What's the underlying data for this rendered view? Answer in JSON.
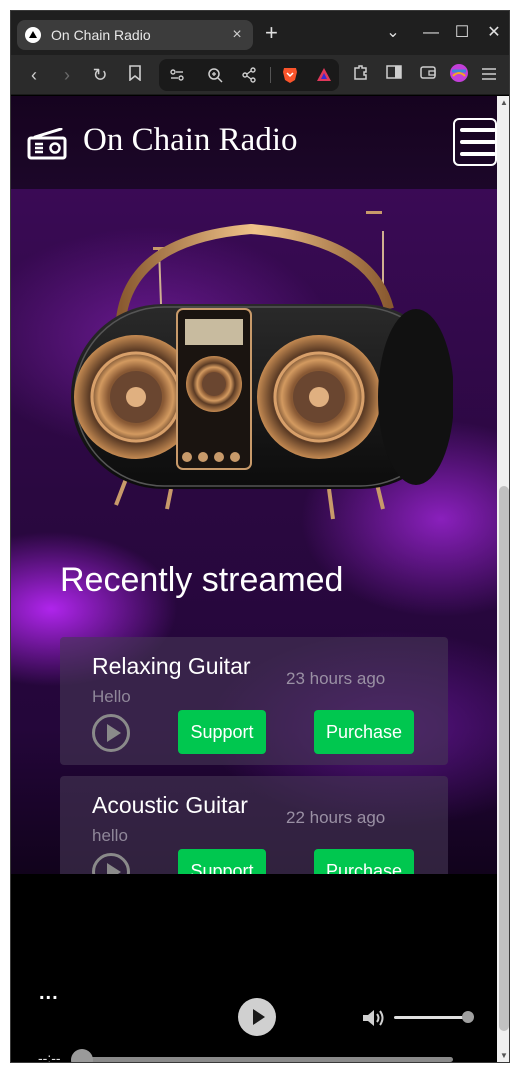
{
  "browser": {
    "tab_title": "On Chain Radio",
    "tab_close": "×",
    "new_tab": "+",
    "win_dropdown": "⌄",
    "win_min": "—",
    "win_max": "☐",
    "win_close": "✕"
  },
  "site": {
    "title": "On Chain Radio"
  },
  "recent": {
    "heading": "Recently streamed",
    "tracks": [
      {
        "title": "Relaxing Guitar",
        "description": "Hello",
        "time": "23 hours ago",
        "support_label": "Support",
        "purchase_label": "Purchase"
      },
      {
        "title": "Acoustic Guitar",
        "description": "hello",
        "time": "22 hours ago",
        "support_label": "Support",
        "purchase_label": "Purchase"
      }
    ]
  },
  "player": {
    "now_playing": "...",
    "time": "--:--",
    "volume": 1.0,
    "progress": 0.0
  },
  "colors": {
    "accent_green": "#00c74f",
    "header_bg": "#16031f",
    "purple_glow": "#be28ff"
  }
}
